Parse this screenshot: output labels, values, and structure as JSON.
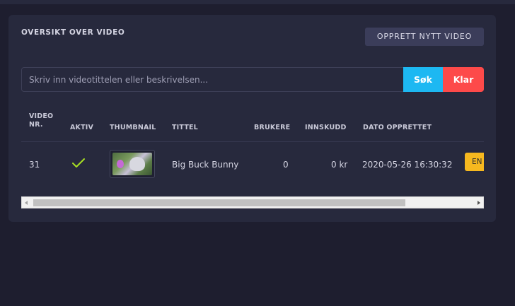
{
  "card": {
    "title": "OVERSIKT OVER VIDEO",
    "create_button": "OPPRETT NYTT VIDEO"
  },
  "search": {
    "placeholder": "Skriv inn videotittelen eller beskrivelsen...",
    "value": "",
    "search_label": "Søk",
    "clear_label": "Klar"
  },
  "table": {
    "headers": {
      "video_nr_line1": "VIDEO",
      "video_nr_line2": "NR.",
      "active": "AKTIV",
      "thumbnail": "THUMBNAIL",
      "title": "TITTEL",
      "users": "BRUKERE",
      "deposit": "INNSKUDD",
      "created": "DATO OPPRETTET"
    },
    "rows": [
      {
        "video_nr": "31",
        "active": true,
        "title": "Big Buck Bunny",
        "users": "0",
        "deposit": "0 kr",
        "created": "2020-05-26 16:30:32",
        "action_label": "EN"
      }
    ]
  },
  "colors": {
    "page_bg": "#1e1e2f",
    "card_bg": "#27293d",
    "search_button": "#1db8f2",
    "clear_button": "#fd4a4a",
    "action_button": "#f6b81f",
    "check": "#a8e022"
  },
  "icons": {
    "active": "check-icon",
    "scroll_left": "scroll-left-arrow-icon",
    "scroll_right": "scroll-right-arrow-icon"
  }
}
